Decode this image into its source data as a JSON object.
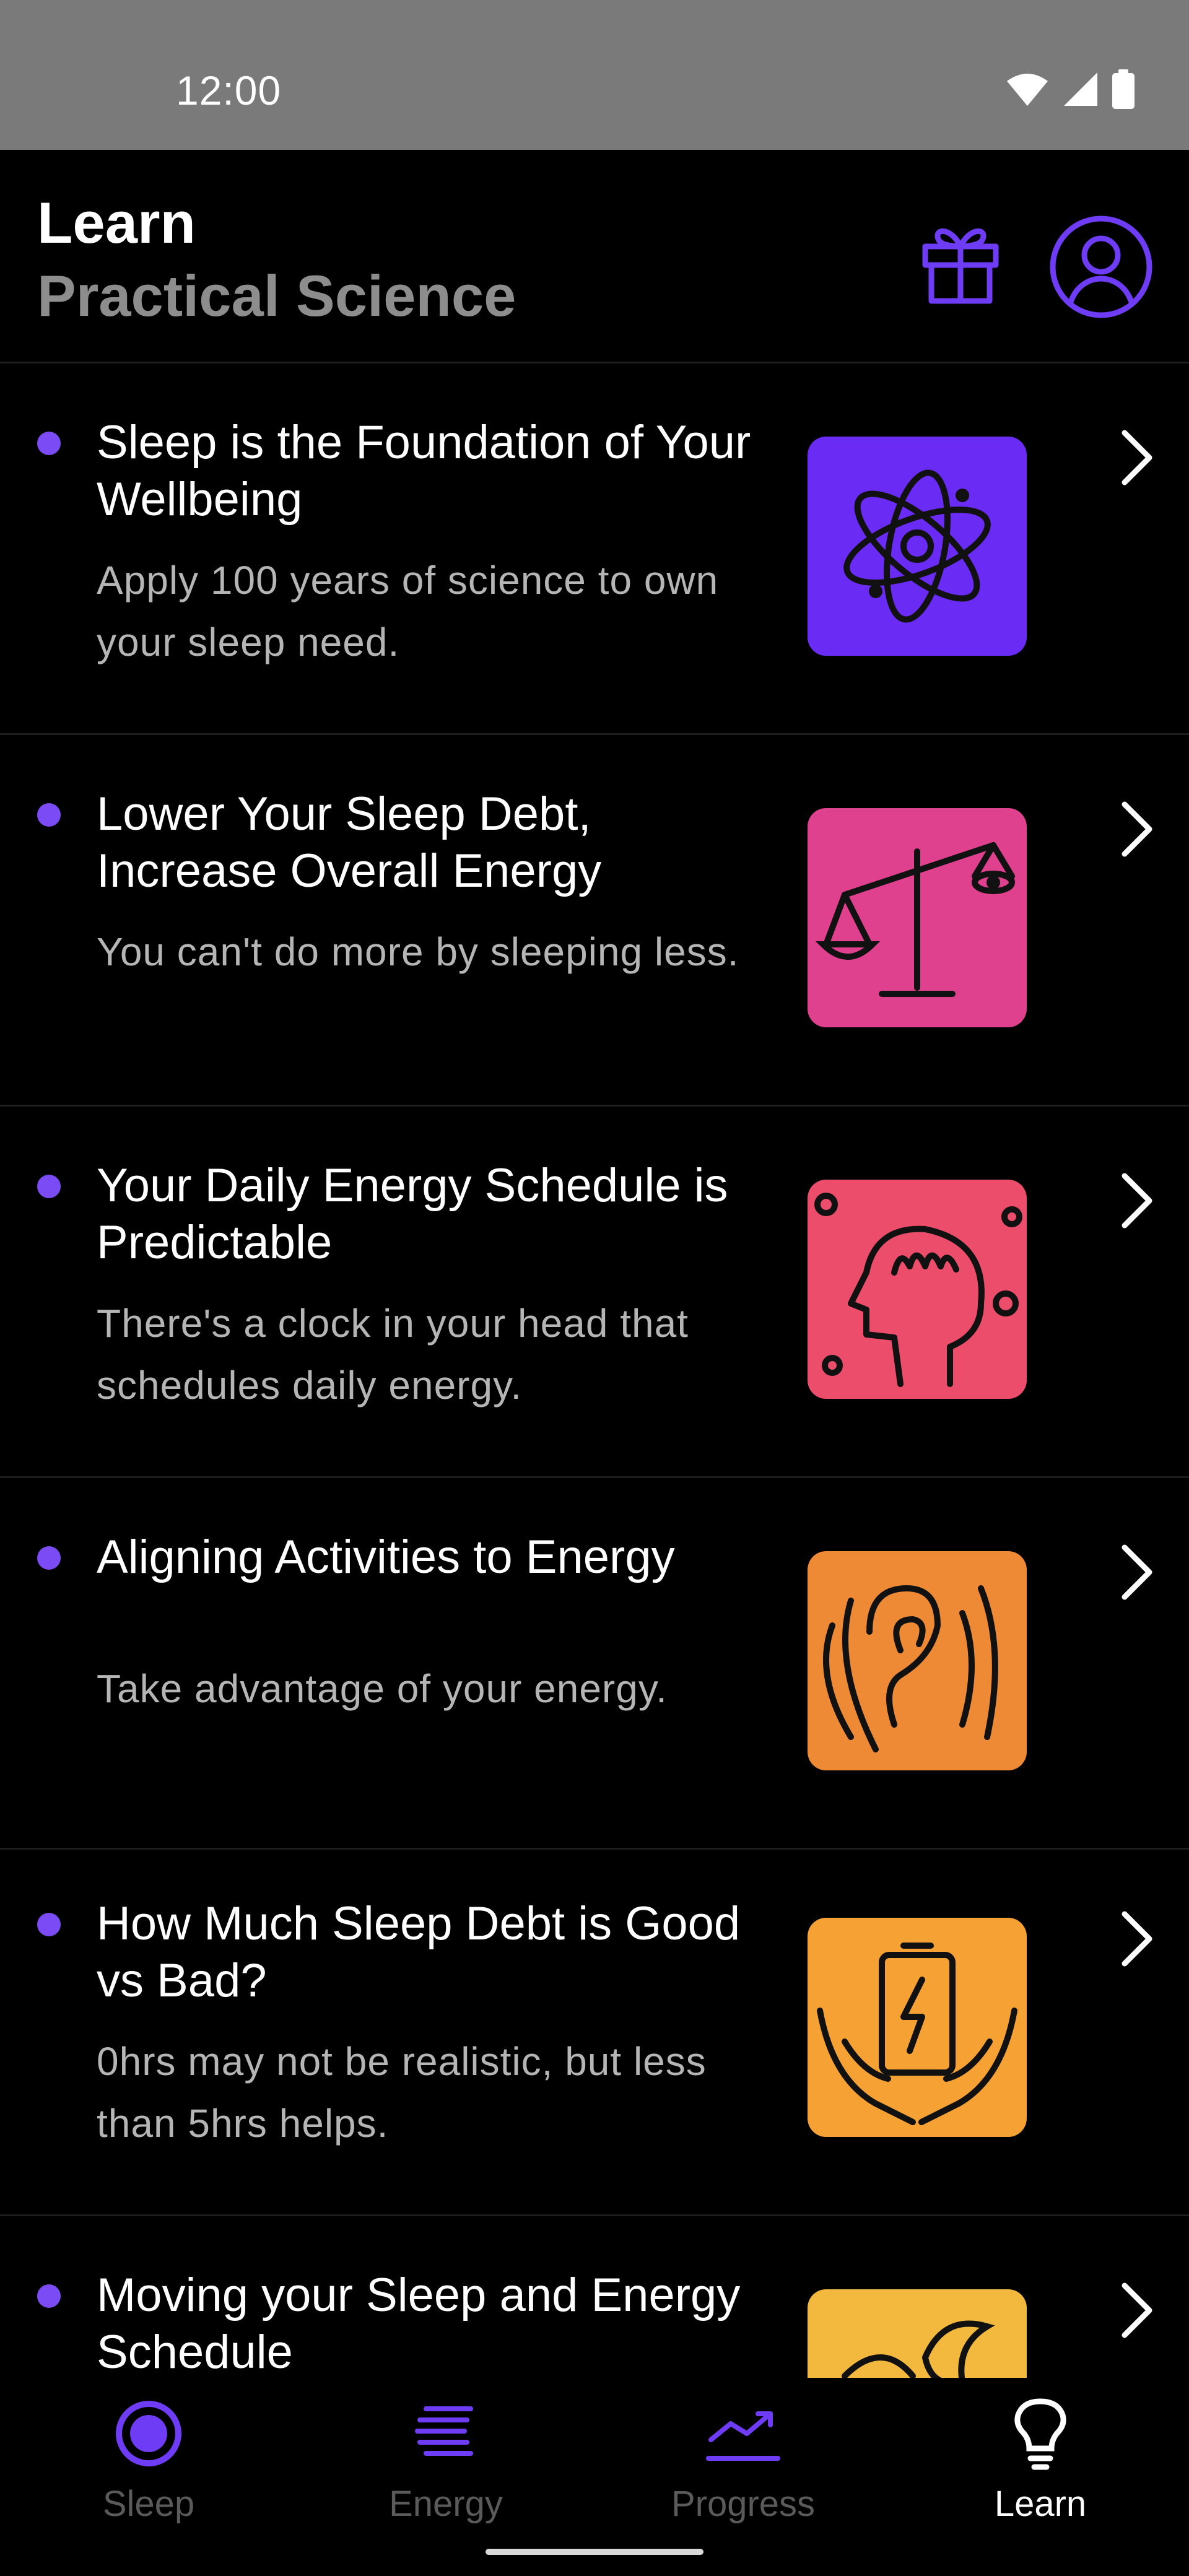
{
  "status_bar": {
    "time": "12:00",
    "icons": [
      "wifi-icon",
      "signal-icon",
      "battery-icon"
    ]
  },
  "header": {
    "title": "Learn",
    "subtitle": "Practical Science",
    "actions": [
      "gift-icon",
      "profile-icon"
    ]
  },
  "colors": {
    "accent": "#6f3cf6",
    "unread_dot": "#7b4cf5",
    "background": "#000000",
    "subtitle": "#8d8d8d",
    "description": "#b5b5b5"
  },
  "lessons": [
    {
      "title": "Sleep is the Foundation of Your Wellbeing",
      "description": "Apply 100 years of science to own your sleep need.",
      "thumb_color": "#6a2cf5",
      "thumb_icon": "flower-icon"
    },
    {
      "title": "Lower Your Sleep Debt, Increase Overall Energy",
      "description": "You can't do more by sleeping less.",
      "thumb_color": "#e0418f",
      "thumb_icon": "balance-scale-icon"
    },
    {
      "title": "Your Daily Energy Schedule is Predictable",
      "description": "There's a clock in your head that schedules daily energy.",
      "thumb_color": "#ec4d6a",
      "thumb_icon": "head-profile-icon"
    },
    {
      "title": "Aligning Activities to Energy",
      "description": "Take advantage of your energy.",
      "thumb_color": "#ee8a35",
      "thumb_icon": "ear-icon"
    },
    {
      "title": "How Much Sleep Debt is Good vs Bad?",
      "description": "0hrs may not be realistic, but less than 5hrs helps.",
      "thumb_color": "#f5a133",
      "thumb_icon": "battery-hands-icon"
    },
    {
      "title": "Moving your Sleep and Energy Schedule",
      "description": "",
      "thumb_color": "#f3b93e",
      "thumb_icon": "moon-icon"
    }
  ],
  "bottom_nav": {
    "items": [
      {
        "label": "Sleep",
        "icon": "sleep-icon"
      },
      {
        "label": "Energy",
        "icon": "energy-icon"
      },
      {
        "label": "Progress",
        "icon": "progress-icon"
      },
      {
        "label": "Learn",
        "icon": "learn-icon"
      }
    ],
    "active": "Learn"
  }
}
